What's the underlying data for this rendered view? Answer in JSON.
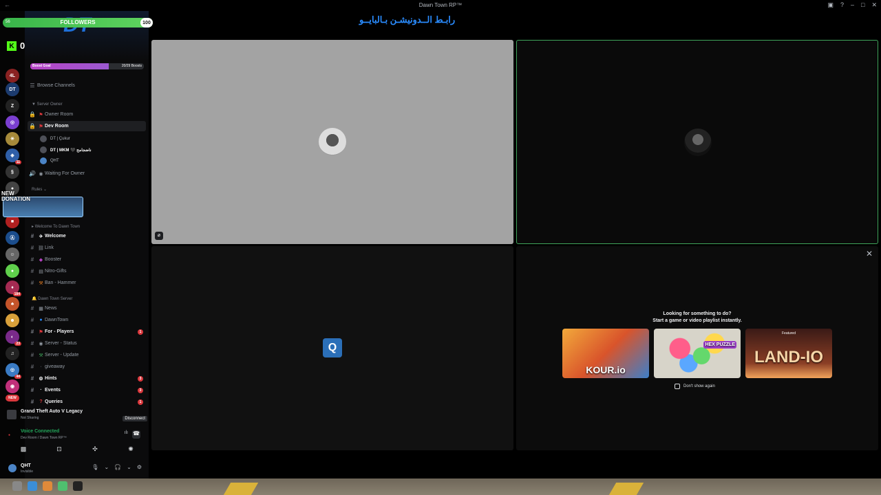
{
  "window": {
    "title": "Dawn Town RP™"
  },
  "overlay": {
    "followers_label": "FOLLOWERS",
    "followers_current": "56",
    "followers_goal": "100",
    "followers_progress": 0.56,
    "kick_count": "0",
    "donation_label": "NEW\nDONATION"
  },
  "server": {
    "boost_goal_label": "Boost Goal",
    "boost_count": "20/29 Boosts",
    "boost_progress": 0.69,
    "browse_label": "Browse Channels"
  },
  "channels": {
    "cat_owner": "Server Owner",
    "owner_room": "Owner Room",
    "dev_room": "Dev Room",
    "voice_users": [
      "DT | Çukur",
      "DT | MKM 🖤 ناضجامح",
      "QHT"
    ],
    "waiting_owner": "Waiting For Owner",
    "cat_rules": "Rules",
    "cat_welcome": "Welcome To Dawn Town",
    "welcome": "Welcome",
    "link": "Link",
    "booster": "Booster",
    "nitro": "Nitro-Gifts",
    "ban": "Ban - Hammer",
    "cat_dawn": "Dawn Town Server",
    "news": "News",
    "dawntown": "DawnTown",
    "for_players": "For - Players",
    "server_status": "Server - Status",
    "server_update": "Server - Update",
    "giveaway": "giveaway",
    "hints": "Hints",
    "events": "Events",
    "queries": "Queries",
    "badges": {
      "for_players": "1",
      "hints": "3",
      "events": "3",
      "queries": "1"
    }
  },
  "activity": {
    "game": "Grand Theft Auto V Legacy",
    "status": "Not Sharing",
    "disconnect": "Disconnect"
  },
  "voice": {
    "status": "Voice Connected",
    "location": "Dev Room / Dawn Town RP™"
  },
  "user": {
    "name": "QHT",
    "status": "Invisible"
  },
  "stage": {
    "arabic_banner": "رابـط الــدونيشـن بـالبايــو",
    "prompt_line1": "Looking for something to do?",
    "prompt_line2": "Start a game or video playlist instantly.",
    "games": [
      "KOUR.io",
      "HEX PUZZLE",
      "LAND-IO"
    ],
    "land_tag": "Featured",
    "dont_show": "Don't show again"
  },
  "colors": {
    "accent_green": "#23a55a",
    "speaking_border": "#3fa55b",
    "alert_red": "#da373c",
    "boost_purple": "#b844c6"
  }
}
